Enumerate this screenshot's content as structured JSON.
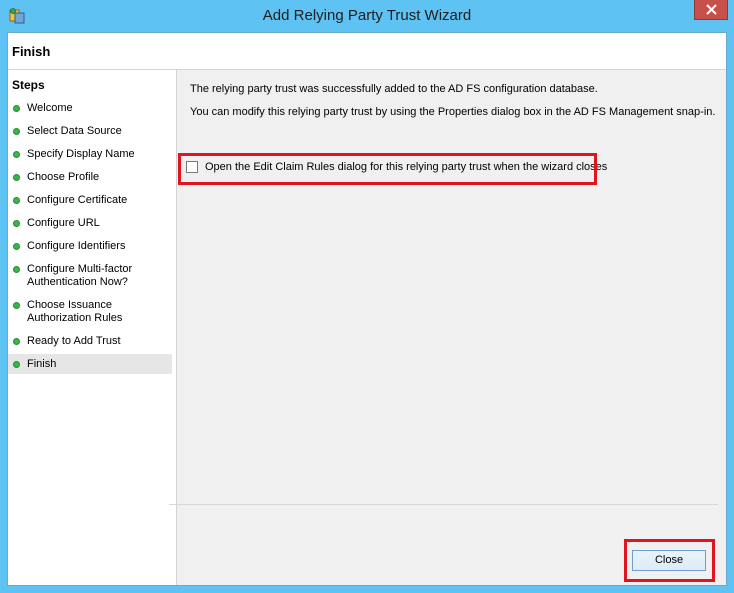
{
  "window": {
    "title": "Add Relying Party Trust Wizard",
    "close_icon": "close-x-icon",
    "app_icon": "ad-fs-wizard-icon"
  },
  "header": {
    "title": "Finish"
  },
  "steps": {
    "title": "Steps",
    "items": [
      {
        "label": "Welcome",
        "status": "done"
      },
      {
        "label": "Select Data Source",
        "status": "done"
      },
      {
        "label": "Specify Display Name",
        "status": "done"
      },
      {
        "label": "Choose Profile",
        "status": "done"
      },
      {
        "label": "Configure Certificate",
        "status": "done"
      },
      {
        "label": "Configure URL",
        "status": "done"
      },
      {
        "label": "Configure Identifiers",
        "status": "done"
      },
      {
        "label": "Configure Multi-factor\nAuthentication Now?",
        "status": "done"
      },
      {
        "label": "Choose Issuance\nAuthorization Rules",
        "status": "done"
      },
      {
        "label": "Ready to Add Trust",
        "status": "done"
      },
      {
        "label": "Finish",
        "status": "current"
      }
    ]
  },
  "content": {
    "message1": "The relying party trust was successfully added to the AD FS configuration database.",
    "message2": "You can modify this relying party trust by using the Properties dialog box in the AD FS Management snap-in.",
    "checkbox_label": "Open the Edit Claim Rules dialog for this relying party trust when the wizard closes",
    "checkbox_checked": false
  },
  "footer": {
    "close_label": "Close"
  },
  "colors": {
    "titlebar": "#5ec2f2",
    "step_dot": "#3bb54a",
    "highlight": "#e0141e"
  }
}
